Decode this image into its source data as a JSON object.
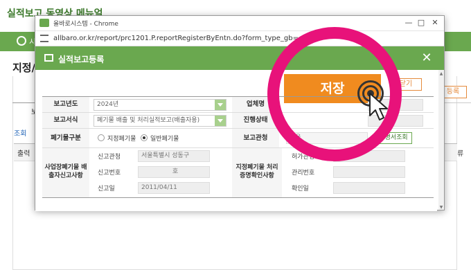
{
  "background": {
    "title": "실적보고 동영상 메뉴얼",
    "nav_text": "시",
    "page_title": "지정/",
    "left_column_label": "보",
    "search_label": "조회",
    "table_first_column": "출력",
    "right_button": "등록",
    "right_column": "류"
  },
  "browser": {
    "title": "올바로시스템 - Chrome",
    "url": "allbaro.or.kr/report/prc1201.P.reportRegisterByEntn.do?form_type_gb=",
    "minimize": "—",
    "maximize": "□",
    "close": "✕"
  },
  "dialog": {
    "title": "실적보고등록",
    "close": "✕",
    "save_label": "저장",
    "close_label": "닫기"
  },
  "form": {
    "report_year_label": "보고년도",
    "report_year_value": "2024년",
    "company_label": "업체명",
    "report_form_label": "보고서식",
    "report_form_value": "폐기물 배출 및 처리실적보고(배출자용)",
    "progress_label": "진행상태",
    "waste_type_label": "폐기물구분",
    "waste_type_options": [
      "지정폐기물",
      "일반폐기물"
    ],
    "waste_type_selected": "일반폐기물",
    "report_office_label": "보고관청",
    "report_office_value": "서울",
    "cert_button": "증명서조회",
    "discharge_label": "사업장폐기물 배출자신고사항",
    "discharge_fields": {
      "office_label": "신고관청",
      "office_value": "서울특별시 성동구",
      "number_label": "신고번호",
      "number_value": "호",
      "date_label": "신고일",
      "date_value": "2011/04/11"
    },
    "treatment_label": "지정폐기물 처리증명확인사항",
    "treatment_fields": {
      "permit_office_label": "허가관청",
      "manage_number_label": "관리번호",
      "confirm_date_label": "확인일"
    }
  },
  "colors": {
    "green": "#6aa84f",
    "orange": "#f08b1f",
    "highlight": "#e8127a"
  }
}
